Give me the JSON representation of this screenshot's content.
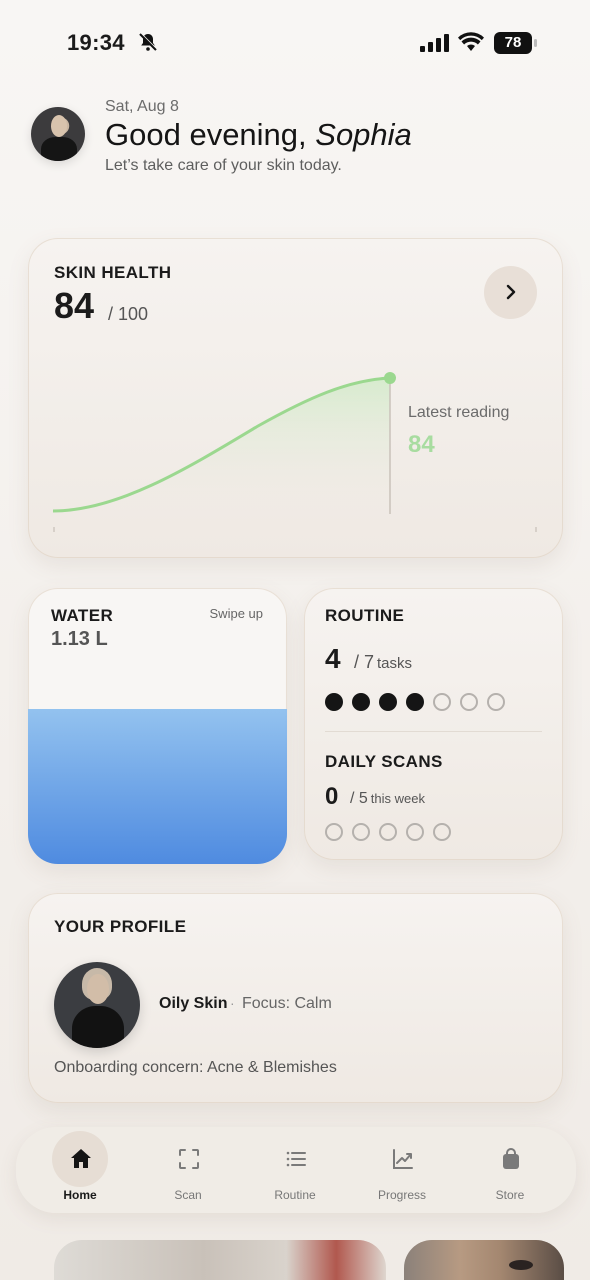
{
  "status_bar": {
    "time": "19:34",
    "battery": "78"
  },
  "header": {
    "date": "Sat, Aug 8",
    "greeting_prefix": "Good evening, ",
    "name": "Sophia",
    "subtitle": "Let’s take care of your skin today."
  },
  "skin_health": {
    "title": "SKIN HEALTH",
    "score": "84",
    "max": "/ 100",
    "latest_label": "Latest reading",
    "latest_value": "84",
    "accent": "#a8dca0",
    "line_color": "#9bd88f"
  },
  "water": {
    "title": "WATER",
    "value": "1.13 L",
    "hint": "Swipe up",
    "fill_fraction": 0.56,
    "colors": [
      "#93c2ef",
      "#4f8be0"
    ]
  },
  "routine": {
    "title": "ROUTINE",
    "done": "4",
    "total": "/ 7",
    "unit": "tasks",
    "done_count": 4,
    "total_count": 7
  },
  "daily_scans": {
    "title": "DAILY SCANS",
    "done": "0",
    "total": "/ 5",
    "unit": "this week",
    "done_count": 0,
    "total_count": 5
  },
  "profile": {
    "title": "YOUR PROFILE",
    "skin_type": "Oily Skin",
    "separator": "·",
    "focus": "Focus: Calm",
    "concern": "Onboarding concern: Acne & Blemishes"
  },
  "nav": {
    "items": [
      {
        "label": "Home",
        "icon": "home-icon",
        "active": true
      },
      {
        "label": "Scan",
        "icon": "scan-icon",
        "active": false
      },
      {
        "label": "Routine",
        "icon": "list-icon",
        "active": false
      },
      {
        "label": "Progress",
        "icon": "chart-icon",
        "active": false
      },
      {
        "label": "Store",
        "icon": "bag-icon",
        "active": false
      }
    ]
  }
}
